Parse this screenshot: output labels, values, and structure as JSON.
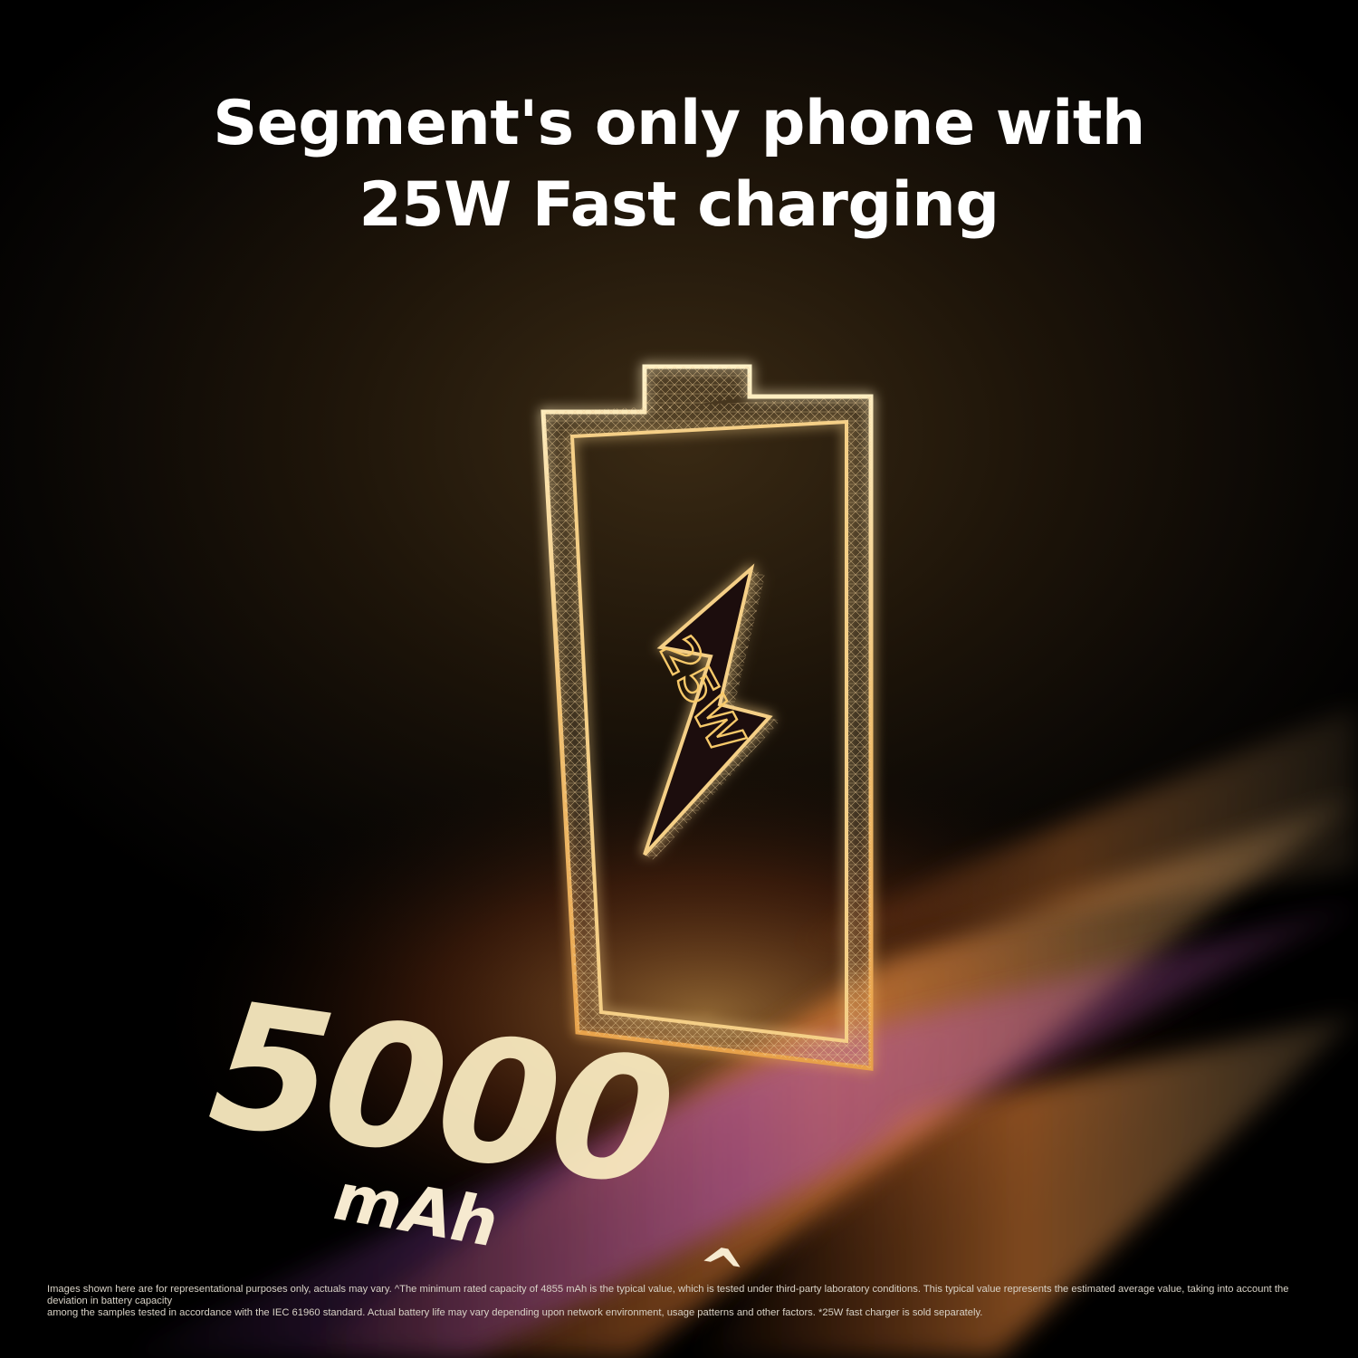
{
  "headline": {
    "line1": "Segment's only phone with",
    "line2": "25W Fast charging"
  },
  "battery": {
    "capacity_value": "5000",
    "capacity_unit": "mAh",
    "capacity_mark": "^",
    "bolt_label": "25W"
  },
  "icons": {
    "battery": "battery-outline-icon",
    "bolt": "lightning-bolt-icon"
  },
  "colors": {
    "background": "#000000",
    "glow": "#f5c56a",
    "streak_orange": "#e8702a",
    "streak_purple": "#8a3fa8",
    "text": "#ffffff"
  },
  "disclaimer": {
    "line1": "Images shown here are for representational purposes only, actuals may vary. ^The minimum rated capacity of 4855 mAh is the typical value, which is tested under third-party laboratory conditions. This typical value represents the estimated average value, taking into account the deviation in battery capacity",
    "line2": "among the samples tested in accordance with the IEC 61960 standard. Actual battery life may vary depending upon network environment, usage patterns and other factors. *25W fast charger is sold separately."
  }
}
